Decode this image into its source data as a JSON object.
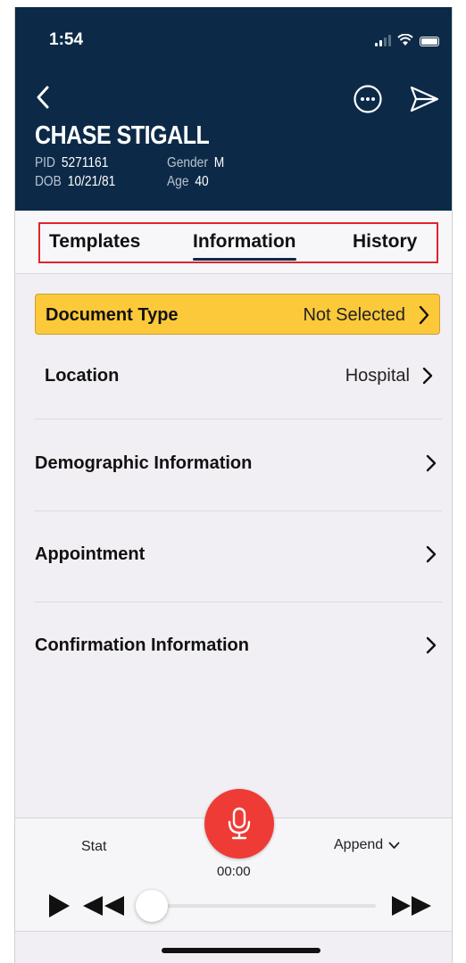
{
  "status_bar": {
    "time": "1:54"
  },
  "patient": {
    "name": "CHASE STIGALL",
    "pid_label": "PID",
    "pid": "5271161",
    "gender_label": "Gender",
    "gender": "M",
    "dob_label": "DOB",
    "dob": "10/21/81",
    "age_label": "Age",
    "age": "40"
  },
  "tabs": [
    {
      "label": "Templates",
      "active": false
    },
    {
      "label": "Information",
      "active": true
    },
    {
      "label": "History",
      "active": false
    }
  ],
  "document_type": {
    "label": "Document Type",
    "value": "Not Selected"
  },
  "rows": [
    {
      "label": "Location",
      "value": "Hospital"
    },
    {
      "label": "Demographic Information",
      "value": ""
    },
    {
      "label": "Appointment",
      "value": ""
    },
    {
      "label": "Confirmation Information",
      "value": ""
    }
  ],
  "recorder": {
    "priority": "Stat",
    "mode": "Append",
    "timer": "00:00",
    "progress": 0
  },
  "colors": {
    "header": "#0c2a47",
    "doc_type_highlight": "#fcc93a",
    "mic": "#ef3b36",
    "tab_outline": "#e0242b"
  },
  "icons": [
    "back-chevron-icon",
    "more-options-icon",
    "send-icon",
    "chevron-right-icon",
    "microphone-icon",
    "play-icon",
    "rewind-icon",
    "fast-forward-icon",
    "chevron-down-icon"
  ]
}
